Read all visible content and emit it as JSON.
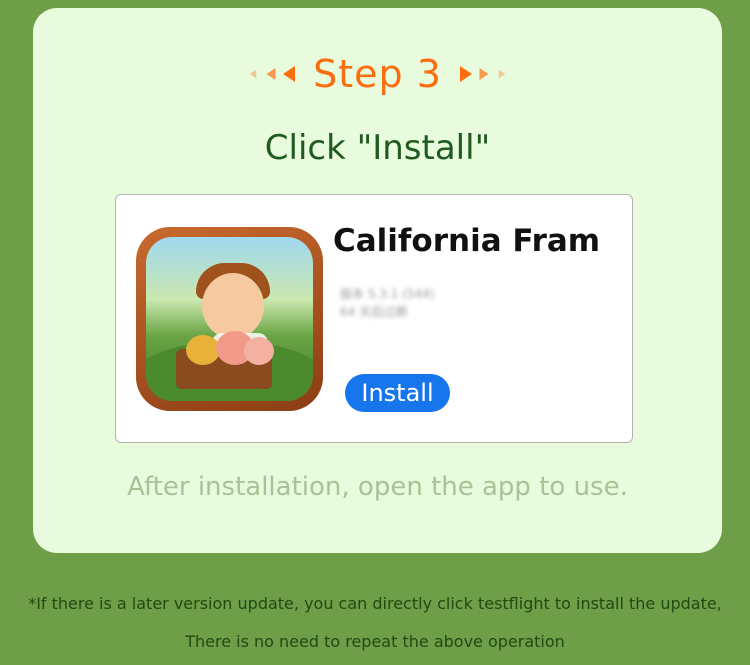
{
  "step": {
    "title": "Step 3"
  },
  "instruction": "Click \"Install\"",
  "app": {
    "name": "California Fram",
    "meta_line1": "版本 5.3.1 (544)",
    "meta_line2": "64 天后过期",
    "install_label": "Install"
  },
  "after_text": "After installation, open the app to use.",
  "footnote": {
    "line1": "*If there is a later version update, you can directly click testflight to install the update,",
    "line2": "There is no need to repeat the above operation"
  },
  "colors": {
    "page_bg": "#6f9e49",
    "card_bg": "#e9fbdd",
    "accent_orange": "#fb6e0f",
    "install_blue": "#1876ec"
  }
}
